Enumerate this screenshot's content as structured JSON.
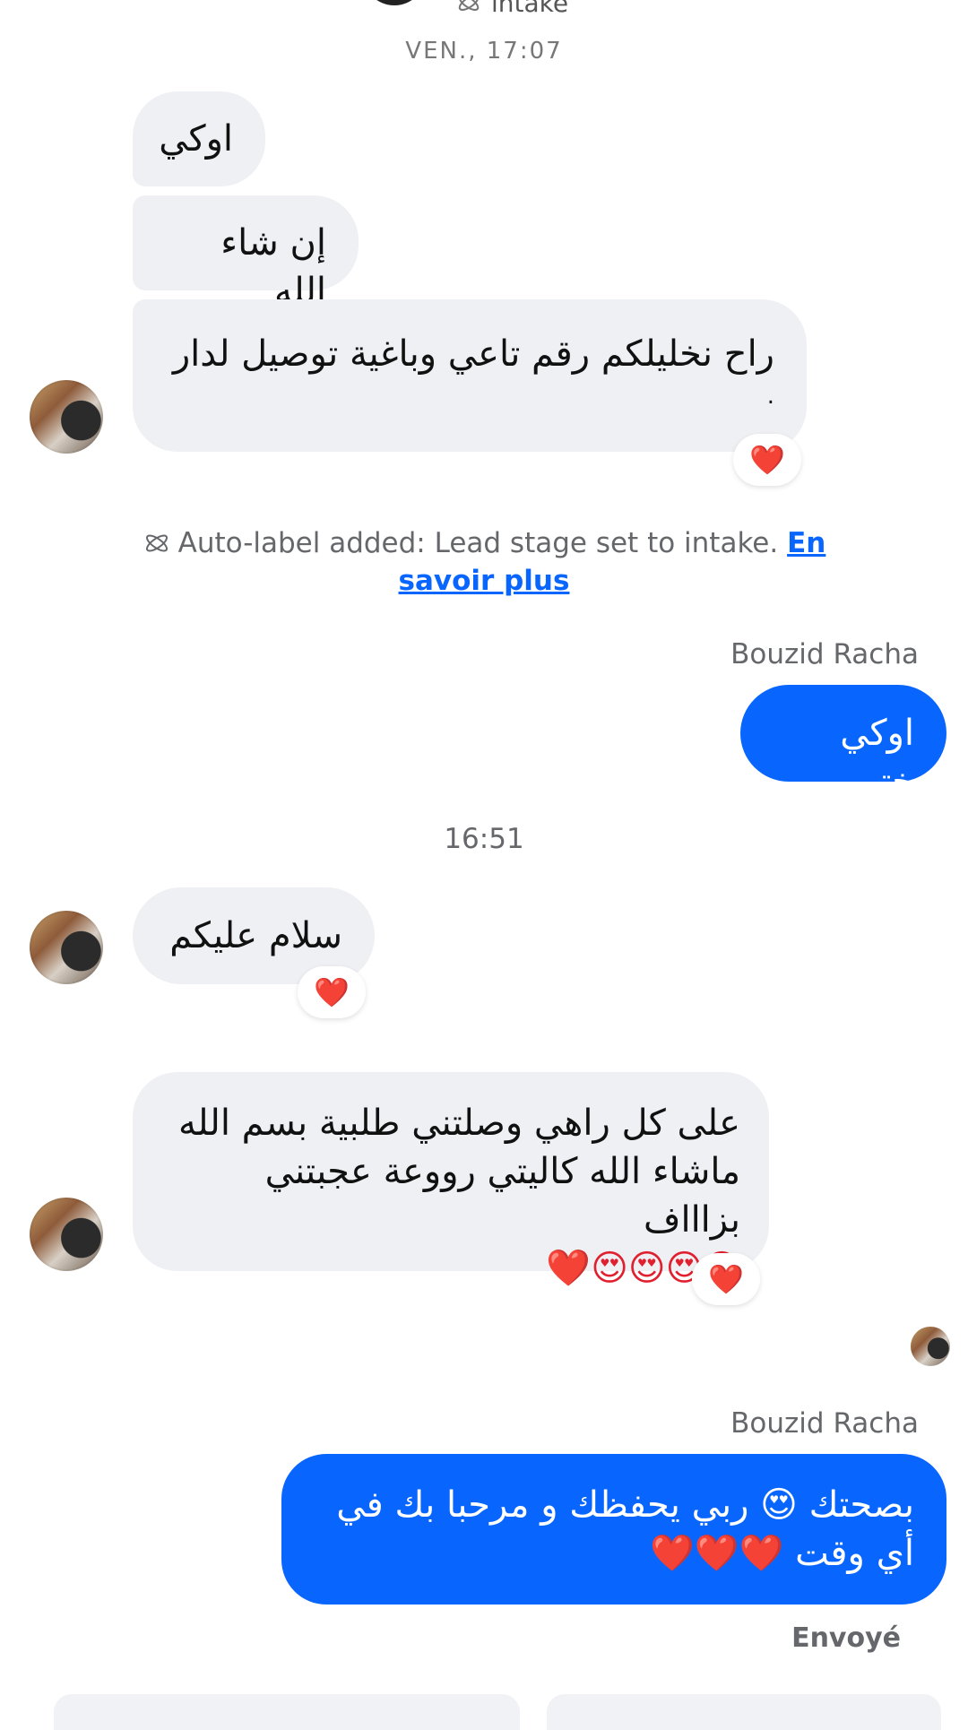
{
  "header": {
    "label_partial": "intake",
    "date_partial": "VEN., 17:07"
  },
  "messages": {
    "m1": "اوكي",
    "m2": "إن شاء الله",
    "m3_line1": "راح نخليلكم رقم تاعي وباغية توصيل لدار",
    "m3_line2": ".",
    "m3_reaction": "❤️"
  },
  "system_note": {
    "text": "Auto-label added: Lead stage set to intake.",
    "link": "En savoir plus"
  },
  "outgoing1": {
    "sender": "Bouzid Racha",
    "text": "اوكي ختي"
  },
  "time2": "16:51",
  "incoming2": {
    "text": "سلام عليكم",
    "reaction": "❤️"
  },
  "incoming3": {
    "line1": "على كل راهي وصلتني طلبية بسم الله",
    "line2": "ماشاء الله كاليتي رووعة عجبتني بزاااف",
    "line3": "😍😍😍😍❤️",
    "reaction": "❤️"
  },
  "outgoing2": {
    "sender": "Bouzid Racha",
    "line1": "بصحتك 😍 ربي يحفظك و مرحبا بك في",
    "line2": "أي وقت ❤️❤️❤️",
    "status": "Envoyé"
  },
  "colors": {
    "incoming_bg": "#eff0f4",
    "outgoing_bg": "#0866ff",
    "link": "#0866ff",
    "meta_text": "#65676b"
  }
}
